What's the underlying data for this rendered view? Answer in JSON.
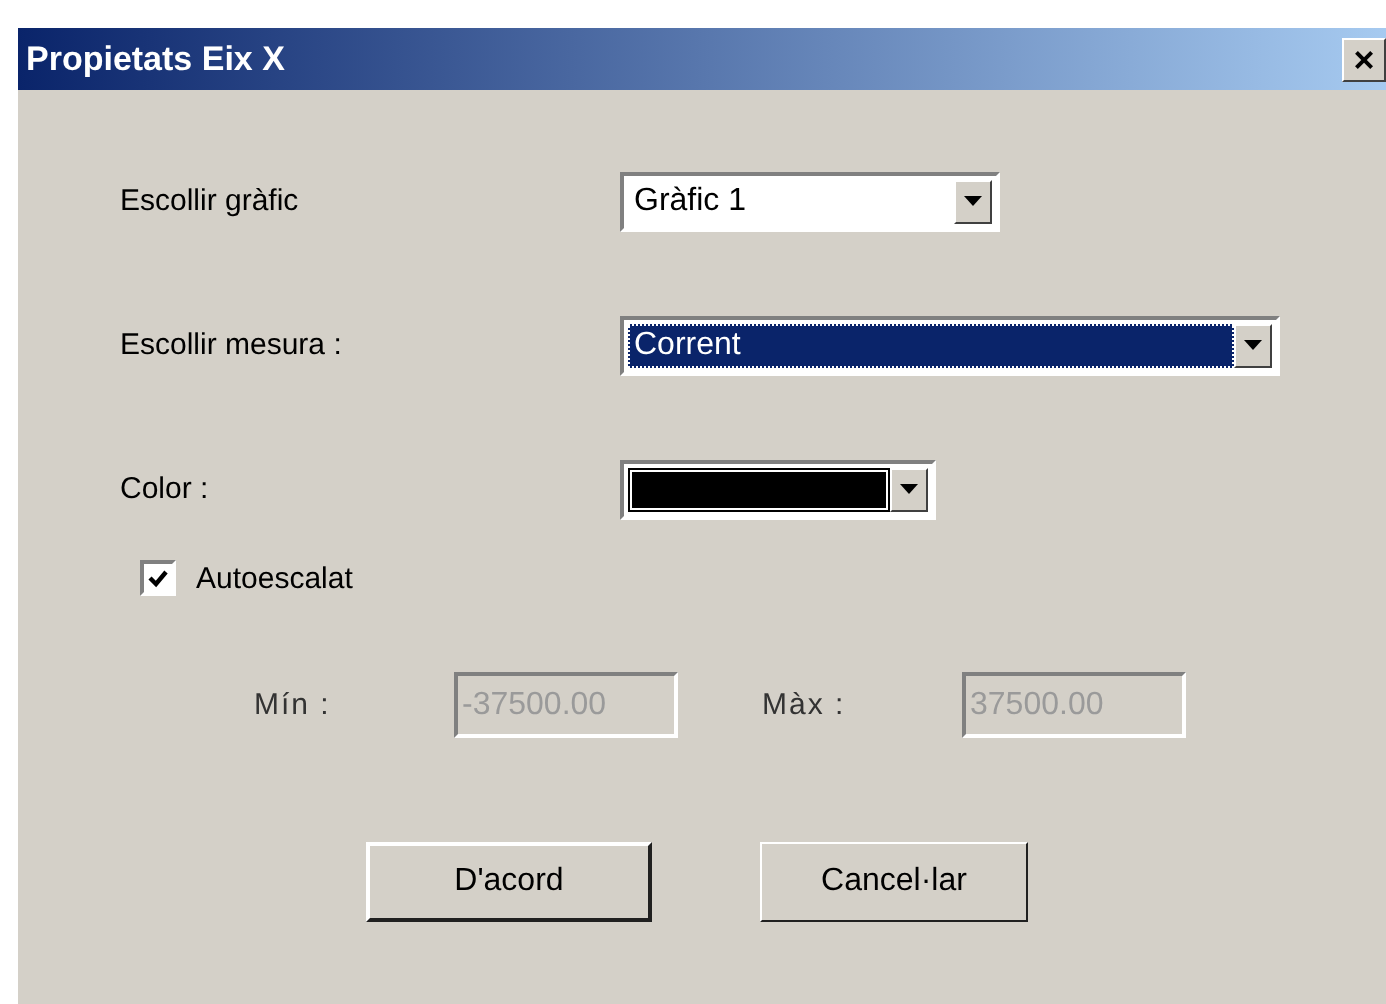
{
  "window": {
    "title": "Propietats Eix X",
    "close": "×"
  },
  "fields": [
    {
      "kind": "combo",
      "label": "Escollir gràfic",
      "value": "Gràfic 1",
      "focused": false
    },
    {
      "kind": "combo",
      "label": "Escollir mesura :",
      "value": "Corrent",
      "focused": true
    },
    {
      "kind": "color",
      "label": "Color :",
      "color": "#000000"
    }
  ],
  "autoscale": {
    "label": "Autoescalat",
    "checked": true
  },
  "range": [
    {
      "label": "Mín :",
      "value": "-37500.00",
      "disabled": true
    },
    {
      "label": "Màx :",
      "value": "37500.00",
      "disabled": true
    }
  ],
  "buttons": [
    {
      "label": "D'acord",
      "default": true
    },
    {
      "label": "Cancel·lar",
      "default": false
    }
  ]
}
